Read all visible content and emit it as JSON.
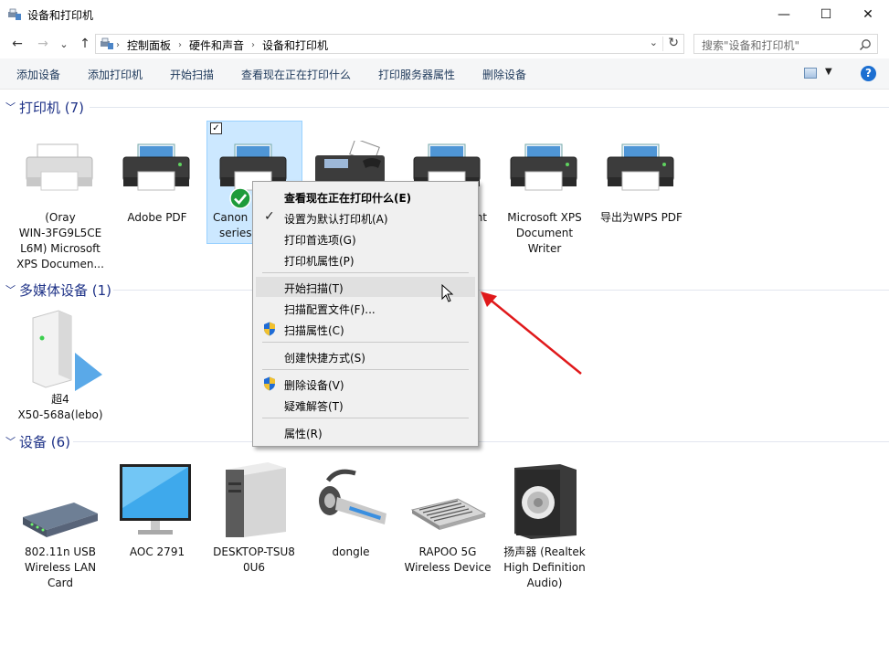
{
  "window": {
    "title": "设备和打印机",
    "minimize": "—",
    "maximize": "☐",
    "close": "✕"
  },
  "nav": {
    "back": "←",
    "forward": "→",
    "recent": "⌄",
    "up": "↑",
    "breadcrumbs": [
      "控制面板",
      "硬件和声音",
      "设备和打印机"
    ],
    "breadcrumb_sep": "›",
    "search_placeholder": "搜索\"设备和打印机\""
  },
  "toolbar": {
    "items": [
      "添加设备",
      "添加打印机",
      "开始扫描",
      "查看现在正在打印什么",
      "打印服务器属性",
      "删除设备"
    ],
    "help": "?"
  },
  "groups": {
    "printers": {
      "title": "打印机 (7)"
    },
    "media": {
      "title": "多媒体设备 (1)"
    },
    "devices": {
      "title": "设备 (6)"
    }
  },
  "printers": [
    {
      "lines": [
        "(Oray",
        "WIN-3FG9L5CE",
        "L6M) Microsoft",
        "XPS Documen..."
      ]
    },
    {
      "lines": [
        "Adobe PDF"
      ]
    },
    {
      "lines": [
        "Canon I",
        "series"
      ]
    },
    {
      "lines": []
    },
    {
      "lines": [
        "nt"
      ]
    },
    {
      "lines": [
        "Microsoft XPS",
        "Document",
        "Writer"
      ]
    },
    {
      "lines": [
        "导出为WPS PDF"
      ]
    }
  ],
  "media": [
    {
      "lines": [
        "超4",
        "X50-568a(lebo)"
      ]
    }
  ],
  "devices": [
    {
      "lines": [
        "802.11n USB",
        "Wireless LAN",
        "Card"
      ]
    },
    {
      "lines": [
        "AOC 2791"
      ]
    },
    {
      "lines": [
        "DESKTOP-TSU8",
        "0U6"
      ]
    },
    {
      "lines": [
        "dongle"
      ]
    },
    {
      "lines": [
        "RAPOO 5G",
        "Wireless Device"
      ]
    },
    {
      "lines": [
        "扬声器 (Realtek",
        "High Definition",
        "Audio)"
      ]
    }
  ],
  "context_menu": {
    "items": [
      {
        "label": "查看现在正在打印什么(E)",
        "bold": true
      },
      {
        "label": "设置为默认打印机(A)",
        "check": true
      },
      {
        "label": "打印首选项(G)"
      },
      {
        "label": "打印机属性(P)"
      },
      {
        "label": "开始扫描(T)",
        "hover": true
      },
      {
        "label": "扫描配置文件(F)..."
      },
      {
        "label": "扫描属性(C)",
        "shield": true
      },
      {
        "label": "创建快捷方式(S)"
      },
      {
        "label": "删除设备(V)",
        "shield": true
      },
      {
        "label": "疑难解答(T)"
      },
      {
        "label": "属性(R)"
      }
    ],
    "check_glyph": "✓"
  },
  "colors": {
    "group_title": "#1e3287",
    "selection": "#cce8ff",
    "annotation_arrow": "#e0191b",
    "default_badge": "#1e9b3a"
  }
}
